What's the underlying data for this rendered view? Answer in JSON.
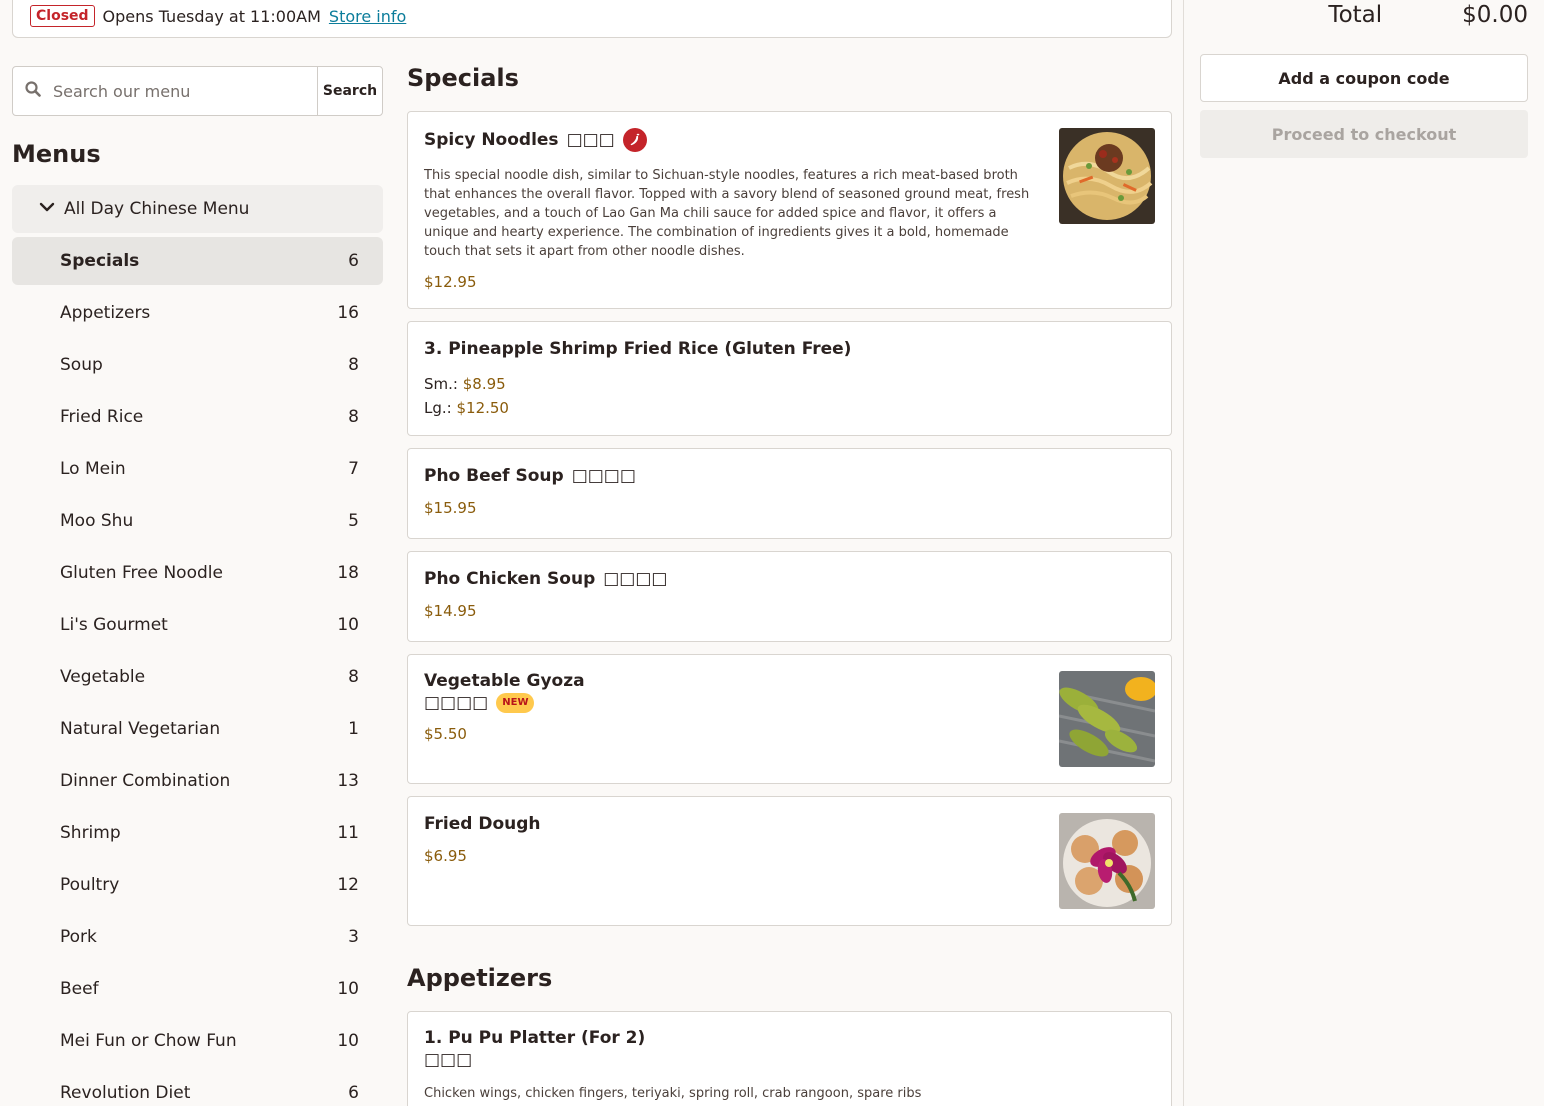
{
  "store_status": {
    "badge": "Closed",
    "message": "Opens Tuesday at 11:00AM",
    "link": "Store info"
  },
  "search": {
    "placeholder": "Search our menu",
    "button": "Search"
  },
  "sidebar": {
    "heading": "Menus",
    "group_label": "All Day Chinese Menu",
    "categories": [
      {
        "name": "Specials",
        "count": "6",
        "active": true
      },
      {
        "name": "Appetizers",
        "count": "16"
      },
      {
        "name": "Soup",
        "count": "8"
      },
      {
        "name": "Fried Rice",
        "count": "8"
      },
      {
        "name": "Lo Mein",
        "count": "7"
      },
      {
        "name": "Moo Shu",
        "count": "5"
      },
      {
        "name": "Gluten Free Noodle",
        "count": "18"
      },
      {
        "name": "Li's Gourmet",
        "count": "10"
      },
      {
        "name": "Vegetable",
        "count": "8"
      },
      {
        "name": "Natural Vegetarian",
        "count": "1"
      },
      {
        "name": "Dinner Combination",
        "count": "13"
      },
      {
        "name": "Shrimp",
        "count": "11"
      },
      {
        "name": "Poultry",
        "count": "12"
      },
      {
        "name": "Pork",
        "count": "3"
      },
      {
        "name": "Beef",
        "count": "10"
      },
      {
        "name": "Mei Fun or Chow Fun",
        "count": "10"
      },
      {
        "name": "Revolution Diet",
        "count": "6"
      }
    ]
  },
  "sections": {
    "specials_heading": "Specials",
    "appetizers_heading": "Appetizers"
  },
  "items": {
    "spicy_noodles": {
      "title": "Spicy Noodles",
      "glyphs": "□□□",
      "description": "This special noodle dish, similar to Sichuan-style noodles, features a rich meat-based broth that enhances the overall flavor. Topped with a savory blend of seasoned ground meat, fresh vegetables, and a touch of Lao Gan Ma chili sauce for added spice and flavor, it offers a unique and hearty experience. The combination of ingredients gives it a bold, homemade touch that sets it apart from other noodle dishes.",
      "price": "$12.95"
    },
    "pineapple_rice": {
      "title": "3. Pineapple Shrimp Fried Rice (Gluten Free)",
      "sm_label": "Sm.:",
      "sm_price": "$8.95",
      "lg_label": "Lg.:",
      "lg_price": "$12.50"
    },
    "pho_beef": {
      "title": "Pho Beef Soup",
      "glyphs": "□□□□",
      "price": "$15.95"
    },
    "pho_chicken": {
      "title": "Pho Chicken Soup",
      "glyphs": "□□□□",
      "price": "$14.95"
    },
    "veg_gyoza": {
      "title": "Vegetable Gyoza",
      "glyphs": "□□□□",
      "badge": "NEW",
      "price": "$5.50"
    },
    "fried_dough": {
      "title": "Fried Dough",
      "price": "$6.95"
    },
    "pu_pu": {
      "title": "1. Pu Pu Platter (For 2)",
      "glyphs": "□□□",
      "description": "Chicken wings, chicken fingers, teriyaki, spring roll, crab rangoon, spare ribs"
    }
  },
  "cart": {
    "total_label": "Total",
    "total_value": "$0.00",
    "coupon_button": "Add a coupon code",
    "checkout_button": "Proceed to checkout"
  },
  "colors": {
    "closed_red": "#c4242a",
    "link_teal": "#0c7d9b",
    "price_brown": "#8a5c0c",
    "new_badge_yellow": "#ffc94d"
  }
}
